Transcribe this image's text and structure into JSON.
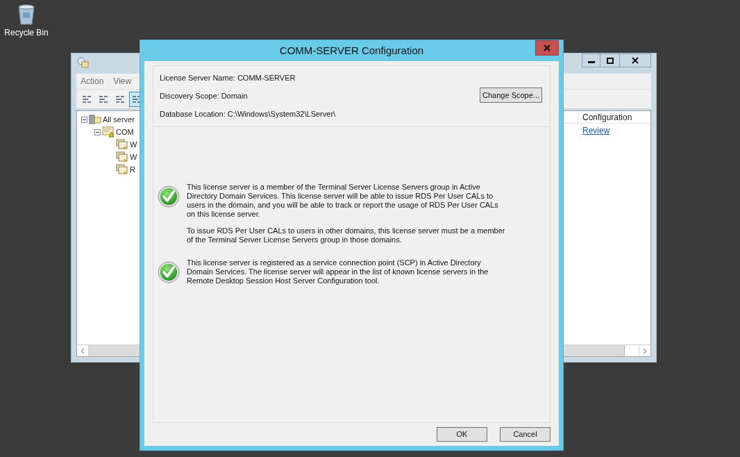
{
  "desktop_icons": [
    {
      "label": "Recycle Bin"
    }
  ],
  "background_window": {
    "menu": [
      "Action",
      "View"
    ],
    "toolbar": [
      {
        "selected": false
      },
      {
        "selected": false
      },
      {
        "selected": false
      },
      {
        "selected": true
      }
    ],
    "tree": [
      {
        "label": "All server",
        "expanded": true,
        "children": [
          {
            "label": "COM",
            "expanded": true,
            "warning": true,
            "children": [
              {
                "label": "W"
              },
              {
                "label": "W"
              },
              {
                "label": "R"
              }
            ]
          }
        ]
      }
    ],
    "columns": [
      "Configuration"
    ],
    "rows": [
      {
        "configuration": "Review"
      }
    ]
  },
  "dialog": {
    "title": "COMM-SERVER Configuration",
    "fields": [
      "License Server Name: COMM-SERVER",
      "Discovery Scope: Domain",
      "Database Location: C:\\Windows\\System32\\LServer\\"
    ],
    "change_scope_button": "Change Scope...",
    "messages": [
      {
        "paragraphs": [
          "This license server is a member of the Terminal Server License Servers group in Active Directory Domain Services. This license server will be able to issue RDS Per User CALs to users in the domain, and you will be able to track or report the usage of RDS Per User CALs on this license server.",
          "To issue RDS Per User CALs to users in other domains, this license server must be a member of the Terminal Server License Servers group in those domains."
        ]
      },
      {
        "paragraphs": [
          "This license server is registered as a service connection point (SCP) in Active Directory Domain Services. The license server will appear in the list of known license servers in the Remote Desktop Session Host Server Configuration tool."
        ]
      }
    ],
    "buttons": [
      "OK",
      "Cancel"
    ]
  }
}
